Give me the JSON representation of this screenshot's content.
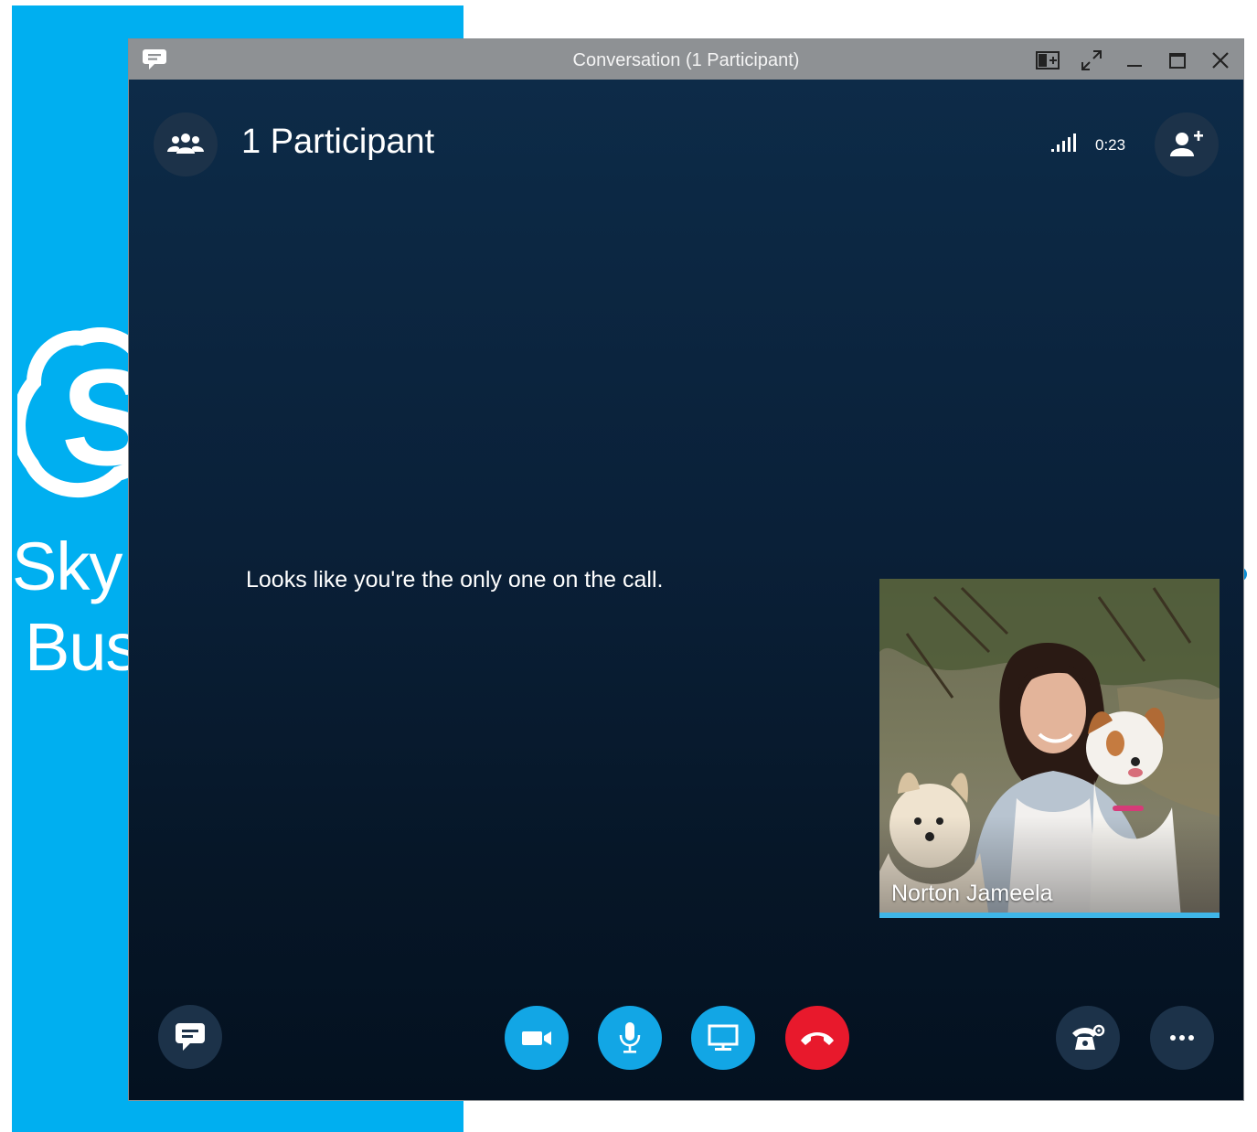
{
  "background": {
    "app_name_line1": "Sky",
    "app_name_line2": "Bus",
    "brand_color": "#00aff0",
    "logo_icon": "skype-logo"
  },
  "window": {
    "title": "Conversation (1 Participant)",
    "title_icon": "chat-bubble-icon",
    "controls": {
      "compact_view": "compact-view-icon",
      "full_screen": "full-screen-icon",
      "minimize": "minimize-icon",
      "maximize": "maximize-icon",
      "close": "close-icon"
    }
  },
  "header": {
    "participants_icon": "people-icon",
    "participant_count_label": "1 Participant",
    "signal_icon": "signal-strength-icon",
    "call_duration": "0:23",
    "add_people_icon": "add-person-icon"
  },
  "stage": {
    "message": "Looks like you're the only one on the call.",
    "self_video": {
      "name": "Norton Jameela"
    }
  },
  "toolbar": {
    "chat": "chat-icon",
    "video": "video-camera-icon",
    "mic": "microphone-icon",
    "share": "present-screen-icon",
    "hangup": "hang-up-icon",
    "call_controls": "call-controls-icon",
    "more": "more-options-icon",
    "colors": {
      "action_blue": "#12a6e5",
      "hangup_red": "#e8192c",
      "dark_button": "#1c3249"
    }
  }
}
